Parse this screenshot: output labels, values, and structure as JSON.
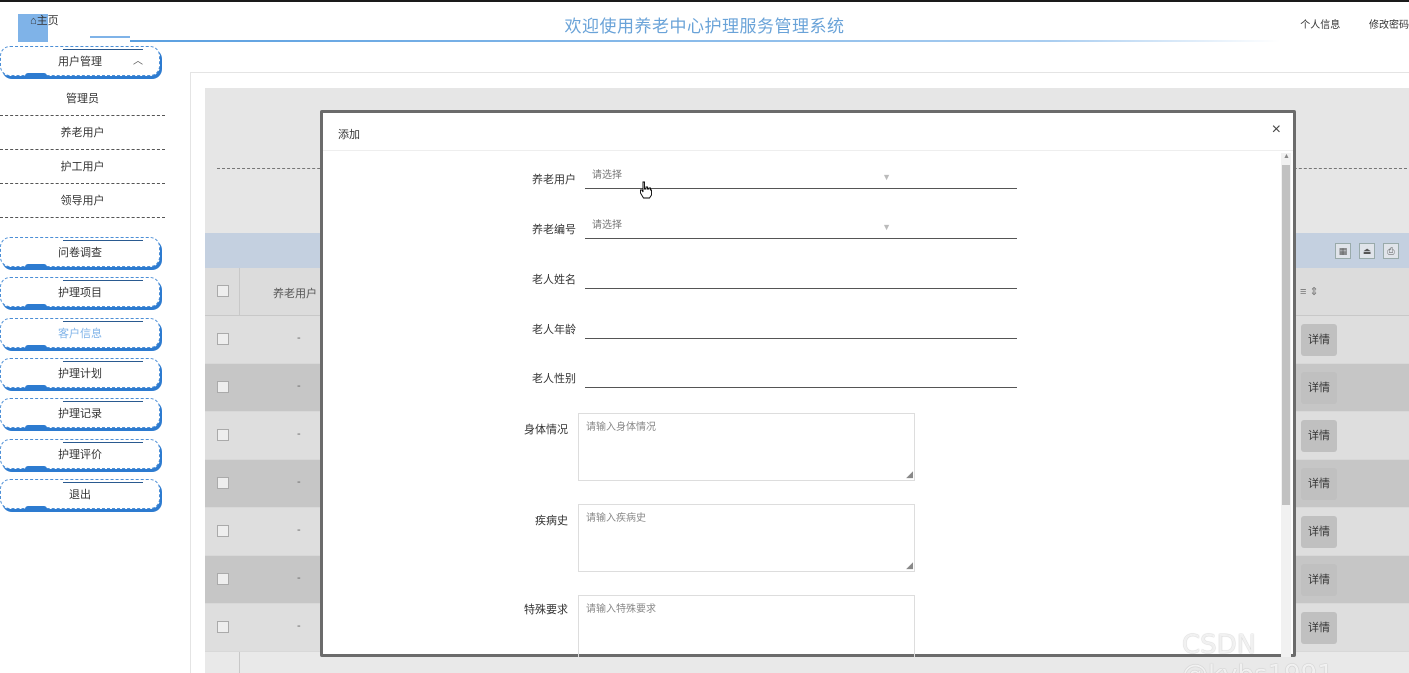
{
  "topbar": {
    "home_label": "⌂主页",
    "title": "欢迎使用养老中心护理服务管理系统",
    "profile_link": "个人信息",
    "password_link": "修改密码"
  },
  "sidebar": {
    "user_management": "用户管理",
    "user_submenu": [
      "管理员",
      "养老用户",
      "护工用户",
      "领导用户"
    ],
    "menu": [
      "问卷调查",
      "护理项目",
      "客户信息",
      "护理计划",
      "护理记录",
      "护理评价",
      "退出"
    ],
    "active_item": "客户信息"
  },
  "background_table": {
    "header_col": "养老用户",
    "sort_mark": "≡ ⇕",
    "row_dash": "-",
    "detail_label": "详情"
  },
  "modal": {
    "title": "添加",
    "close": "×",
    "fields": {
      "elder_user": {
        "label": "养老用户",
        "placeholder": "请选择"
      },
      "elder_no": {
        "label": "养老编号",
        "placeholder": "请选择"
      },
      "elder_name": {
        "label": "老人姓名",
        "value": ""
      },
      "elder_age": {
        "label": "老人年龄",
        "value": ""
      },
      "elder_gender": {
        "label": "老人性别",
        "value": ""
      },
      "health": {
        "label": "身体情况",
        "placeholder": "请输入身体情况"
      },
      "history": {
        "label": "疾病史",
        "placeholder": "请输入疾病史"
      },
      "special": {
        "label": "特殊要求",
        "placeholder": "请输入特殊要求"
      }
    }
  },
  "watermark": "CSDN @kybs1991",
  "colors": {
    "accent": "#7fb3e8",
    "menu_border": "#2d7bd0",
    "title": "#6aa3d8"
  }
}
